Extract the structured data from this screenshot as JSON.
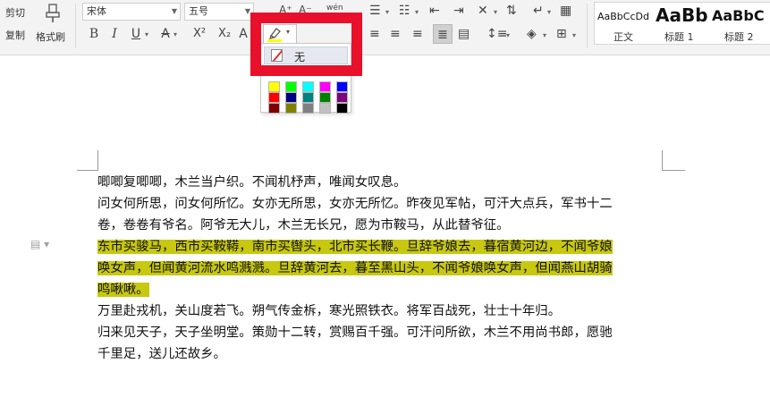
{
  "ribbon": {
    "cut_label": "剪切",
    "copy_label": "复制",
    "format_painter_label": "格式刷",
    "font_name": "宋体",
    "font_size": "五号",
    "wen_label": "wén",
    "bold": "B",
    "italic": "I",
    "underline": "U",
    "superscript": "X²",
    "subscript": "X₂",
    "char_shading": "A",
    "styles": [
      {
        "preview": "AaBbCcDd",
        "name": "正文"
      },
      {
        "preview": "AaBb",
        "name": "标题 1"
      },
      {
        "preview": "AaBbC",
        "name": "标题 2"
      }
    ]
  },
  "highlight_menu": {
    "none_label": "无",
    "colors": [
      [
        "#ffff00",
        "#00ff00",
        "#00ffff",
        "#ff00ff",
        "#0000ff"
      ],
      [
        "#ff0000",
        "#000080",
        "#008080",
        "#008000",
        "#800080"
      ],
      [
        "#800000",
        "#808000",
        "#808080",
        "#c0c0c0",
        "#000000"
      ]
    ]
  },
  "document": {
    "lines": [
      "唧唧复唧唧，木兰当户织。不闻机杼声，唯闻女叹息。",
      "问女何所思，问女何所忆。女亦无所思，女亦无所忆。昨夜见军帖，可汗大点兵，军书十二",
      "卷，卷卷有爷名。阿爷无大儿，木兰无长兄，愿为市鞍马，从此替爷征。",
      "东市买骏马，西市买鞍鞯，南市买辔头，北市买长鞭。旦辞爷娘去，暮宿黄河边，不闻爷娘",
      "唤女声，但闻黄河流水鸣溅溅。旦辞黄河去，暮至黑山头，不闻爷娘唤女声，但闻燕山胡骑",
      "鸣啾啾。",
      "万里赴戎机，关山度若飞。朔气传金柝，寒光照铁衣。将军百战死，壮士十年归。",
      "归来见天子，天子坐明堂。策勋十二转，赏赐百千强。可汗问所欲，木兰不用尚书郎，愿驰",
      "千里足，送儿还故乡。"
    ]
  }
}
